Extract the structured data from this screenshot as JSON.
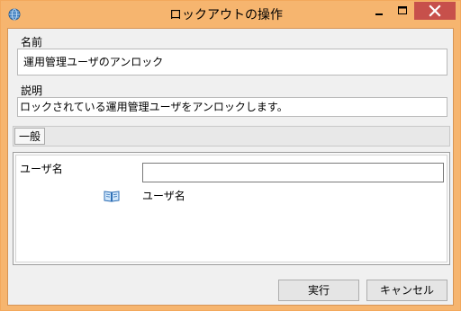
{
  "window": {
    "title": "ロックアウトの操作",
    "icon": "globe-icon",
    "controls": [
      "minimize-icon",
      "maximize-icon",
      "close-icon"
    ]
  },
  "fields": {
    "name": {
      "label": "名前",
      "value": "運用管理ユーザのアンロック"
    },
    "description": {
      "label": "説明",
      "value": "ロックされている運用管理ユーザをアンロックします。"
    }
  },
  "tabs": [
    {
      "label": "一般"
    }
  ],
  "general": {
    "username_label": "ユーザ名",
    "username_value": "",
    "hint_icon": "book-icon",
    "hint_text": "ユーザ名"
  },
  "buttons": {
    "execute": "実行",
    "cancel": "キャンセル"
  },
  "colors": {
    "titlebar": "#f6b56f",
    "close_button": "#c7504b",
    "client_bg": "#f0f0f0"
  }
}
